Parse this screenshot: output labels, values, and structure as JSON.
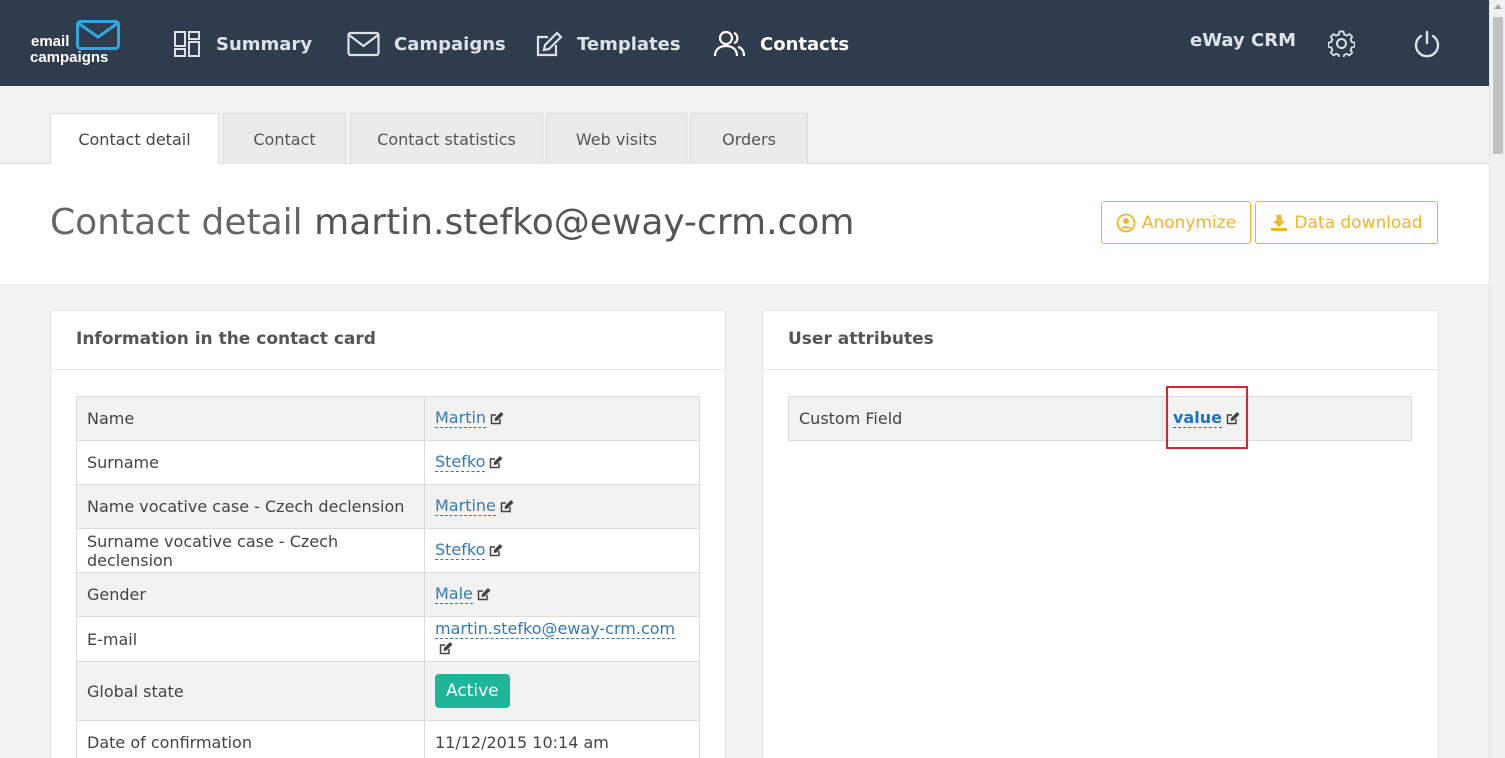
{
  "logo": {
    "line1": "email",
    "line2": "campaigns"
  },
  "nav": [
    {
      "label": "Summary",
      "icon": "dashboard-icon"
    },
    {
      "label": "Campaigns",
      "icon": "envelope-icon"
    },
    {
      "label": "Templates",
      "icon": "edit-icon"
    },
    {
      "label": "Contacts",
      "icon": "users-icon",
      "active": true
    }
  ],
  "header_right": {
    "crm_label": "eWay CRM",
    "settings_icon": "gear-icon",
    "power_icon": "power-icon"
  },
  "tabs": [
    {
      "label": "Contact detail",
      "active": true
    },
    {
      "label": "Contact"
    },
    {
      "label": "Contact statistics"
    },
    {
      "label": "Web visits"
    },
    {
      "label": "Orders"
    }
  ],
  "title": {
    "prefix": "Contact detail",
    "email": "martin.stefko@eway-crm.com"
  },
  "buttons": {
    "anonymize": "Anonymize",
    "download": "Data download"
  },
  "info_panel": {
    "heading": "Information in the contact card",
    "rows": [
      {
        "label": "Name",
        "value": "Martin"
      },
      {
        "label": "Surname",
        "value": "Stefko"
      },
      {
        "label": "Name vocative case - Czech declension",
        "value": "Martine"
      },
      {
        "label": "Surname vocative case - Czech declension",
        "value": "Stefko"
      },
      {
        "label": "Gender",
        "value": "Male"
      },
      {
        "label": "E-mail",
        "value": "martin.stefko@eway-crm.com"
      },
      {
        "label": "Global state",
        "value": "Active"
      },
      {
        "label": "Date of confirmation",
        "value": "11/12/2015 10:14 am"
      }
    ]
  },
  "user_attributes": {
    "heading": "User attributes",
    "rows": [
      {
        "label": "Custom Field",
        "value": "value"
      }
    ]
  },
  "colors": {
    "header_bg": "#2e3c4e",
    "accent": "#f0b429",
    "link": "#337ab7",
    "active_badge": "#1fb59a",
    "highlight": "#d9252e"
  }
}
